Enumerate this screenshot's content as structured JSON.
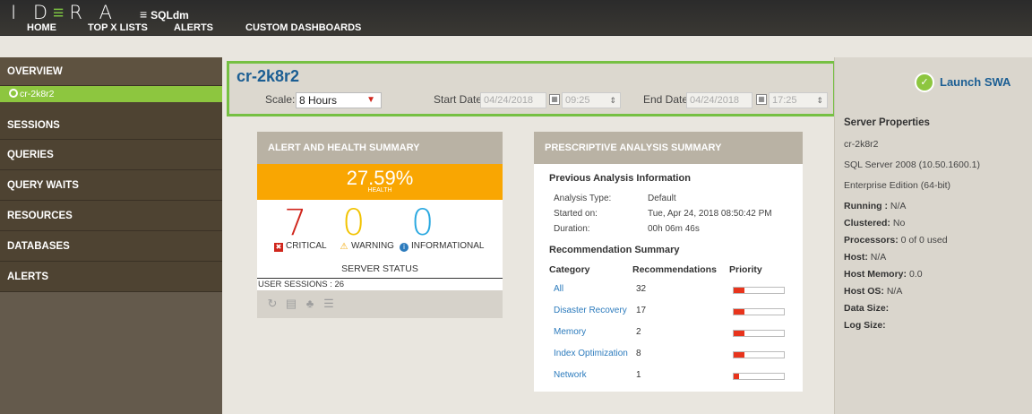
{
  "app": {
    "logo": "IDERA",
    "product": "SQLdm"
  },
  "nav": [
    "HOME",
    "TOP X LISTS",
    "ALERTS",
    "CUSTOM DASHBOARDS"
  ],
  "sidebar": {
    "items": [
      "OVERVIEW",
      "SESSIONS",
      "QUERIES",
      "QUERY WAITS",
      "RESOURCES",
      "DATABASES",
      "ALERTS"
    ],
    "active_server": "cr-2k8r2"
  },
  "header": {
    "server_name": "cr-2k8r2",
    "scale_label": "Scale:",
    "scale_value": "8 Hours",
    "start_label": "Start Date:",
    "start_date": "04/24/2018",
    "start_time": "09:25",
    "end_label": "End Date:",
    "end_date": "04/24/2018",
    "end_time": "17:25"
  },
  "alert_card": {
    "title": "ALERT AND HEALTH SUMMARY",
    "health_value": "27.59%",
    "health_label": "HEALTH",
    "critical_count": "7",
    "warning_count": "0",
    "info_count": "0",
    "critical_label": "CRITICAL",
    "warning_label": "WARNING",
    "info_label": "INFORMATIONAL",
    "server_status": "SERVER STATUS",
    "user_sessions": "USER SESSIONS : 26",
    "colors": {
      "critical": "#d0261c",
      "warning": "#f2c300",
      "info": "#29a8e0",
      "health": "#f9a602"
    }
  },
  "pa_card": {
    "title": "PRESCRIPTIVE ANALYSIS SUMMARY",
    "prev_title": "Previous Analysis Information",
    "info": [
      {
        "key": "Analysis Type:",
        "value": "Default"
      },
      {
        "key": "Started on:",
        "value": "Tue, Apr 24, 2018 08:50:42 PM"
      },
      {
        "key": "Duration:",
        "value": "00h 06m 46s"
      }
    ],
    "rec_title": "Recommendation Summary",
    "columns": [
      "Category",
      "Recommendations",
      "Priority"
    ],
    "rows": [
      {
        "category": "All",
        "count": "32",
        "priority": 0.22
      },
      {
        "category": "Disaster Recovery",
        "count": "17",
        "priority": 0.22
      },
      {
        "category": "Memory",
        "count": "2",
        "priority": 0.22
      },
      {
        "category": "Index Optimization",
        "count": "8",
        "priority": 0.22
      },
      {
        "category": "Network",
        "count": "1",
        "priority": 0.1
      }
    ]
  },
  "right_panel": {
    "launch_label": "Launch SWA",
    "title": "Server Properties",
    "server": "cr-2k8r2",
    "version": "SQL Server 2008 (10.50.1600.1)",
    "edition": "Enterprise Edition (64-bit)",
    "running_label": "Running :",
    "running_value": "N/A",
    "clustered_label": "Clustered:",
    "clustered_value": "No",
    "processors_label": "Processors:",
    "processors_value": "0 of 0 used",
    "host_label": "Host:",
    "host_value": "N/A",
    "host_memory_label": "Host Memory:",
    "host_memory_value": "0.0",
    "host_os_label": "Host OS:",
    "host_os_value": "N/A",
    "data_size_label": "Data Size:",
    "log_size_label": "Log Size:"
  }
}
